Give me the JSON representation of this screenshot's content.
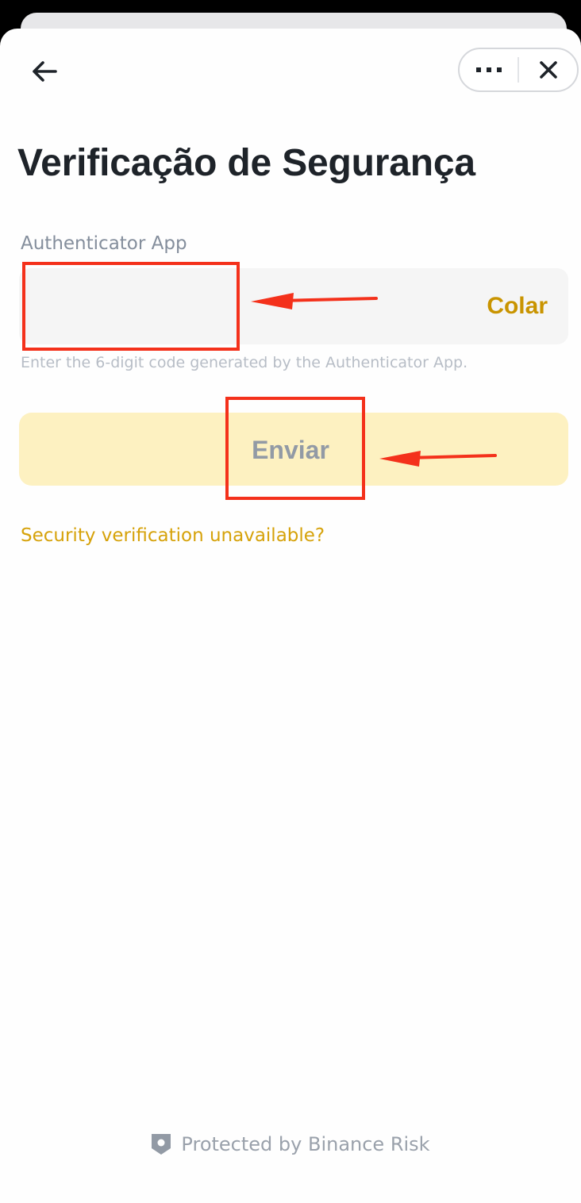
{
  "header": {
    "back_icon": "arrow-left-icon",
    "more_icon": "more-dots-icon",
    "close_icon": "close-icon"
  },
  "page": {
    "title": "Verificação de Segurança"
  },
  "authenticator": {
    "label": "Authenticator App",
    "value": "",
    "paste_label": "Colar",
    "hint": "Enter the 6-digit code generated by the Authenticator App."
  },
  "submit": {
    "label": "Enviar"
  },
  "links": {
    "unavailable": "Security verification unavailable?"
  },
  "footer": {
    "icon": "shield-icon",
    "text": "Protected by Binance Risk"
  },
  "colors": {
    "accent": "#c99400",
    "link": "#d6a20a",
    "button_bg": "#fdf1c1",
    "annotation": "#f4311b"
  }
}
